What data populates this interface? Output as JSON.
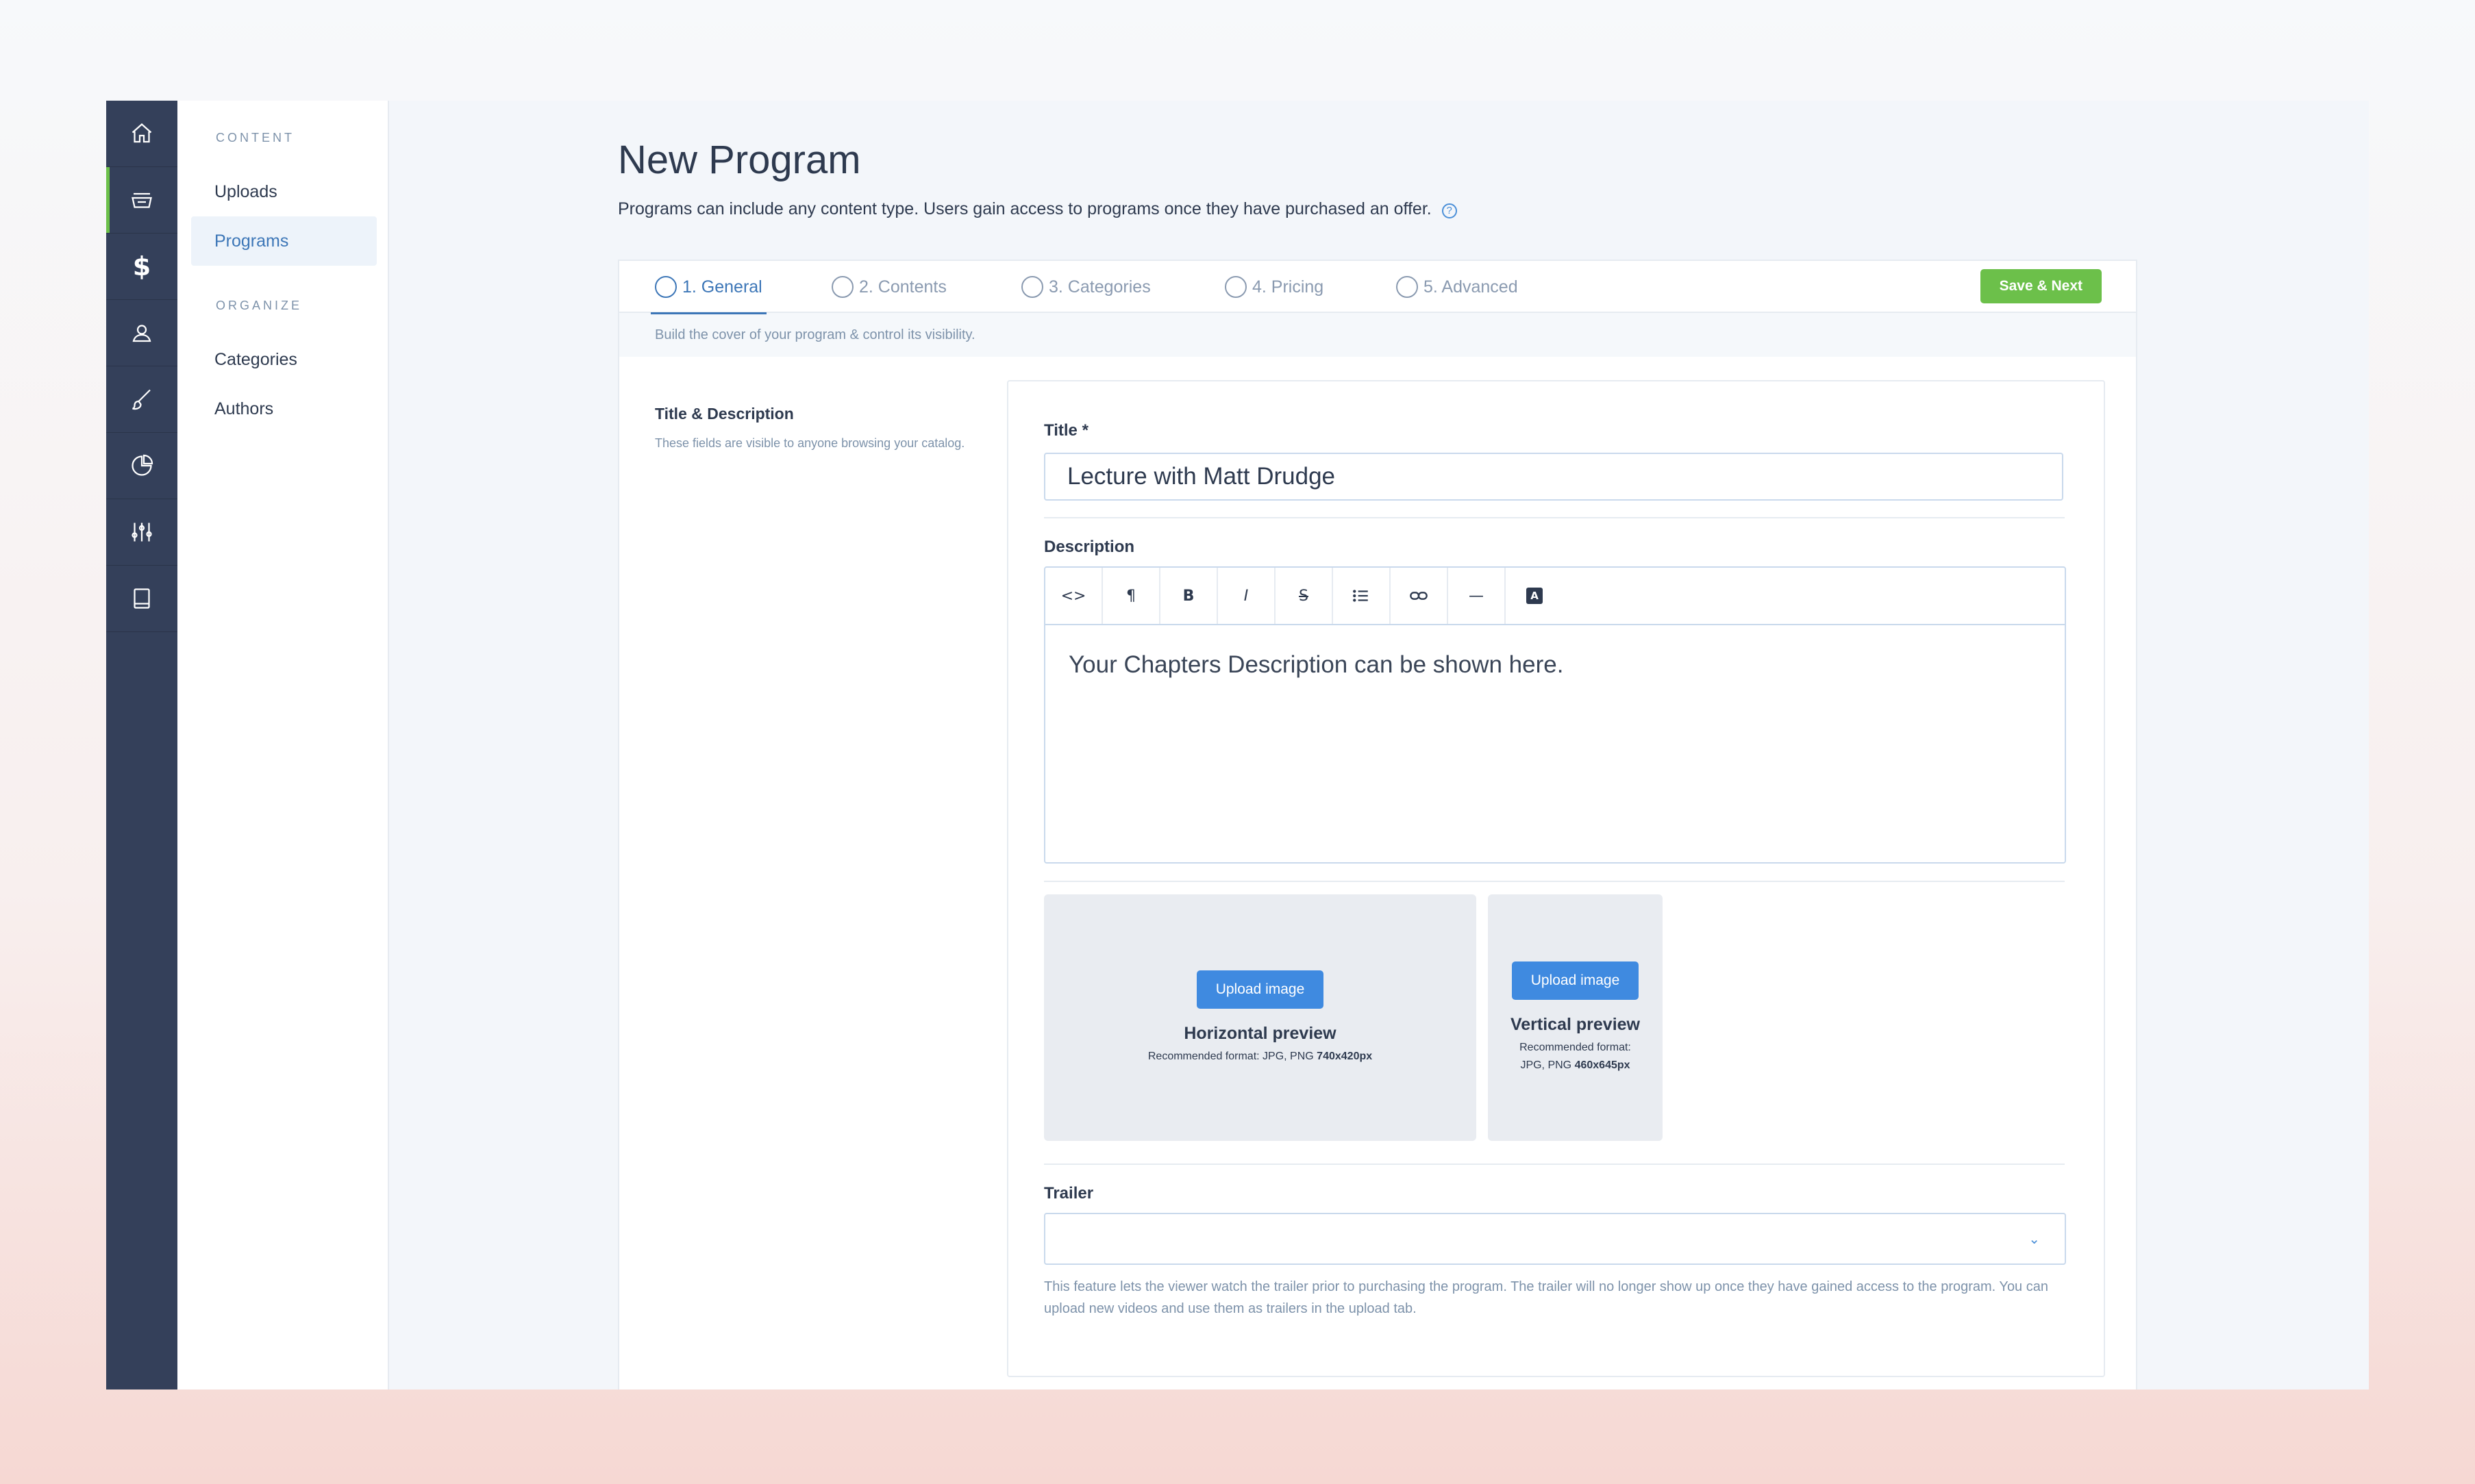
{
  "rail": {
    "items": [
      {
        "name": "home-icon"
      },
      {
        "name": "inbox-icon",
        "active": true
      },
      {
        "name": "dollar-icon",
        "glyph": "$"
      },
      {
        "name": "user-icon"
      },
      {
        "name": "brush-icon"
      },
      {
        "name": "pie-chart-icon"
      },
      {
        "name": "sliders-icon"
      },
      {
        "name": "book-icon"
      }
    ]
  },
  "subnav": {
    "content_heading": "CONTENT",
    "content_items": [
      "Uploads",
      "Programs"
    ],
    "organize_heading": "ORGANIZE",
    "organize_items": [
      "Categories",
      "Authors"
    ]
  },
  "page": {
    "title": "New Program",
    "subtitle": "Programs can include any content type. Users gain access to programs once they have purchased an offer.",
    "help_glyph": "?"
  },
  "tabs": [
    "1. General",
    "2. Contents",
    "3. Categories",
    "4. Pricing",
    "5. Advanced"
  ],
  "save_label": "Save & Next",
  "tab_hint": "Build the cover of your program & control its visibility.",
  "section": {
    "heading": "Title & Description",
    "text": "These fields are visible to anyone browsing your catalog."
  },
  "form": {
    "title_label": "Title *",
    "title_value": "Lecture with Matt Drudge",
    "description_label": "Description",
    "description_value": "Your Chapters Description can be shown here.",
    "toolbar": [
      "<>",
      "¶",
      "B",
      "I",
      "S",
      "list",
      "link",
      "—",
      "A"
    ],
    "horizontal": {
      "button": "Upload image",
      "title": "Horizontal preview",
      "format": "Recommended format: JPG, PNG",
      "size": "740x420px"
    },
    "vertical": {
      "button": "Upload image",
      "title": "Vertical preview",
      "format_line1": "Recommended format:",
      "format_line2": "JPG, PNG",
      "size": "460x645px"
    },
    "trailer_label": "Trailer",
    "trailer_value": "",
    "trailer_help": "This feature lets the viewer watch the trailer prior to purchasing the program. The trailer will no longer show up once they have gained access to the program. You can upload new videos and use them as trailers in the upload tab."
  },
  "colors": {
    "rail": "#34405a",
    "accent_green": "#6cc04a",
    "accent_blue": "#3c76b7",
    "button_blue": "#3f8ae0"
  }
}
